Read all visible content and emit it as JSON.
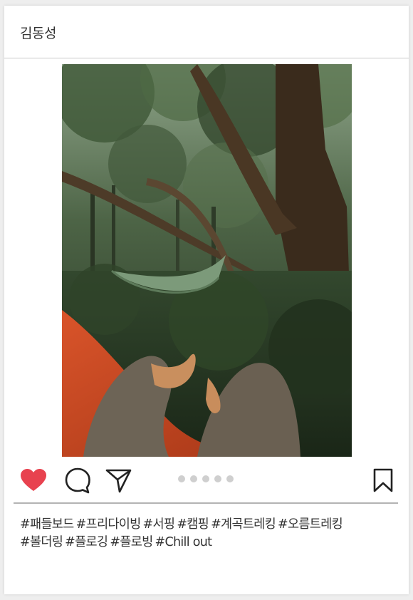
{
  "post": {
    "username": "김동성",
    "image_alt": "Hammocks in a forest",
    "carousel": {
      "total_slides": 5
    },
    "hashtags": [
      "#패들보드",
      "#프리다이빙",
      "#서핑",
      "#캠핑",
      "#계곡트레킹",
      "#오름트레킹",
      "#볼더링",
      "#플로깅",
      "#플로빙",
      "#Chill out"
    ]
  },
  "actions": {
    "like_icon": "heart-icon",
    "comment_icon": "comment-bubble-icon",
    "share_icon": "paper-plane-icon",
    "save_icon": "bookmark-icon",
    "liked": true
  },
  "colors": {
    "like": "#e8424f",
    "icon": "#222222",
    "dot": "#cfcfcf",
    "text": "#333333"
  }
}
